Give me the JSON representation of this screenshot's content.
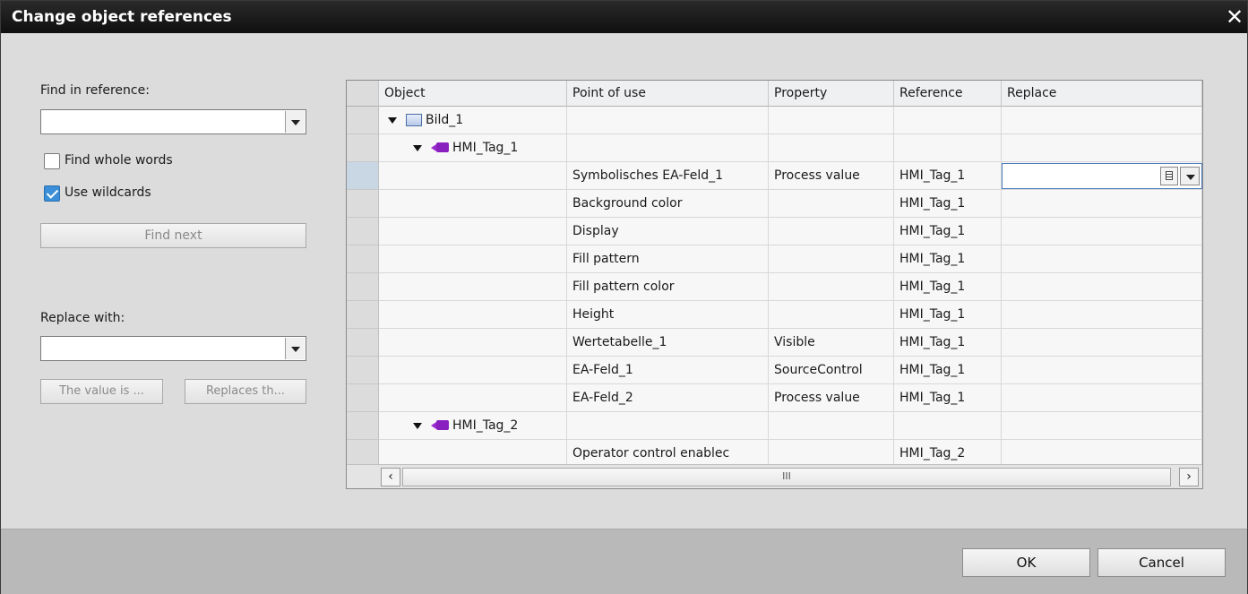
{
  "dialog": {
    "title": "Change object references",
    "close_glyph": "✕"
  },
  "find": {
    "label": "Find in reference:",
    "value": "",
    "whole_words_label": "Find whole words",
    "whole_words_checked": false,
    "wildcards_label": "Use wildcards",
    "wildcards_checked": true,
    "find_next_label": "Find next"
  },
  "replace": {
    "label": "Replace with:",
    "value": "",
    "btn1_label": "The value is ...",
    "btn2_label": "Replaces th..."
  },
  "table": {
    "columns": [
      "Object",
      "Point of use",
      "Property",
      "Reference",
      "Replace"
    ],
    "rows": [
      {
        "object": "Bild_1",
        "point": "",
        "property": "",
        "reference": "",
        "replace": ""
      },
      {
        "object": "HMI_Tag_1",
        "point": "",
        "property": "",
        "reference": "",
        "replace": ""
      },
      {
        "object": "",
        "point": "Symbolisches EA-Feld_1",
        "property": "Process value",
        "reference": "HMI_Tag_1",
        "replace": ""
      },
      {
        "object": "",
        "point": "Background color",
        "property": "",
        "reference": "HMI_Tag_1",
        "replace": ""
      },
      {
        "object": "",
        "point": "Display",
        "property": "",
        "reference": "HMI_Tag_1",
        "replace": ""
      },
      {
        "object": "",
        "point": "Fill pattern",
        "property": "",
        "reference": "HMI_Tag_1",
        "replace": ""
      },
      {
        "object": "",
        "point": "Fill pattern color",
        "property": "",
        "reference": "HMI_Tag_1",
        "replace": ""
      },
      {
        "object": "",
        "point": "Height",
        "property": "",
        "reference": "HMI_Tag_1",
        "replace": ""
      },
      {
        "object": "",
        "point": "Wertetabelle_1",
        "property": "Visible",
        "reference": "HMI_Tag_1",
        "replace": ""
      },
      {
        "object": "",
        "point": "EA-Feld_1",
        "property": "SourceControl",
        "reference": "HMI_Tag_1",
        "replace": ""
      },
      {
        "object": "",
        "point": "EA-Feld_2",
        "property": "Process value",
        "reference": "HMI_Tag_1",
        "replace": ""
      },
      {
        "object": "HMI_Tag_2",
        "point": "",
        "property": "",
        "reference": "",
        "replace": ""
      },
      {
        "object": "",
        "point": "Operator control enablec",
        "property": "",
        "reference": "HMI_Tag_2",
        "replace": ""
      }
    ],
    "scroll_left": "‹",
    "scroll_thumb": "III",
    "scroll_right": "›"
  },
  "footer": {
    "ok_label": "OK",
    "cancel_label": "Cancel"
  }
}
